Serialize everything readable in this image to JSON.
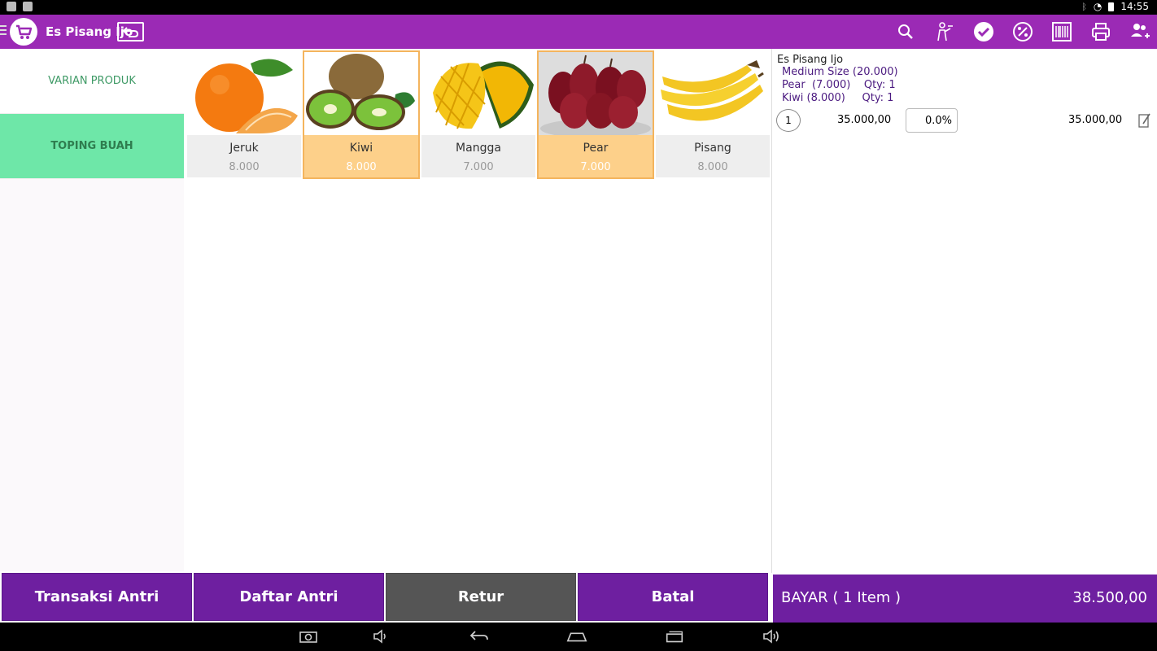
{
  "status": {
    "time": "14:55"
  },
  "appbar": {
    "title": "Es Pisang Ijo"
  },
  "categories": [
    {
      "label": "VARIAN PRODUK",
      "active": false
    },
    {
      "label": "TOPING BUAH",
      "active": true
    }
  ],
  "products": [
    {
      "name": "Jeruk",
      "price": "8.000",
      "selected": false
    },
    {
      "name": "Kiwi",
      "price": "8.000",
      "selected": true
    },
    {
      "name": "Mangga",
      "price": "7.000",
      "selected": false
    },
    {
      "name": "Pear",
      "price": "7.000",
      "selected": true
    },
    {
      "name": "Pisang",
      "price": "8.000",
      "selected": false
    }
  ],
  "cart": {
    "product_name": "Es Pisang Ijo",
    "modifiers": [
      {
        "text": "Medium Size (20.000)"
      },
      {
        "text": "Pear  (7.000)    Qty: 1"
      },
      {
        "text": "Kiwi (8.000)     Qty: 1"
      }
    ],
    "qty": "1",
    "unit_price": "35.000,00",
    "discount": "0.0%",
    "line_total": "35.000,00"
  },
  "buttons": {
    "queue_tx": "Transaksi Antri",
    "queue_list": "Daftar Antri",
    "return": "Retur",
    "cancel": "Batal"
  },
  "pay": {
    "label": "BAYAR ( 1 Item )",
    "amount": "38.500,00"
  },
  "colors": {
    "primary": "#9b2ab5",
    "button": "#6e1fa0",
    "selected": "#fdd08a",
    "category_active": "#6ee7a8"
  }
}
